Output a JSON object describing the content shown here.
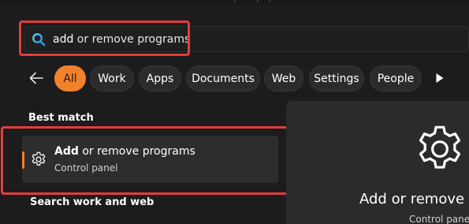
{
  "search": {
    "typed": "add",
    "rest": " or remove programs"
  },
  "filters": [
    {
      "label": "All",
      "active": true
    },
    {
      "label": "Work",
      "active": false
    },
    {
      "label": "Apps",
      "active": false
    },
    {
      "label": "Documents",
      "active": false
    },
    {
      "label": "Web",
      "active": false
    },
    {
      "label": "Settings",
      "active": false
    },
    {
      "label": "People",
      "active": false
    }
  ],
  "best_match": {
    "heading": "Best match",
    "title_bold": "Add",
    "title_rest": " or remove programs",
    "subtitle": "Control panel",
    "icon": "gear-icon"
  },
  "search_work_web": {
    "heading": "Search work and web"
  },
  "preview": {
    "title": "Add or remove pr",
    "subtitle": "Control panel",
    "icon": "gear-icon"
  },
  "colors": {
    "accent": "#f0822d",
    "highlight": "#e33c3c",
    "background": "#1c1c1c"
  }
}
